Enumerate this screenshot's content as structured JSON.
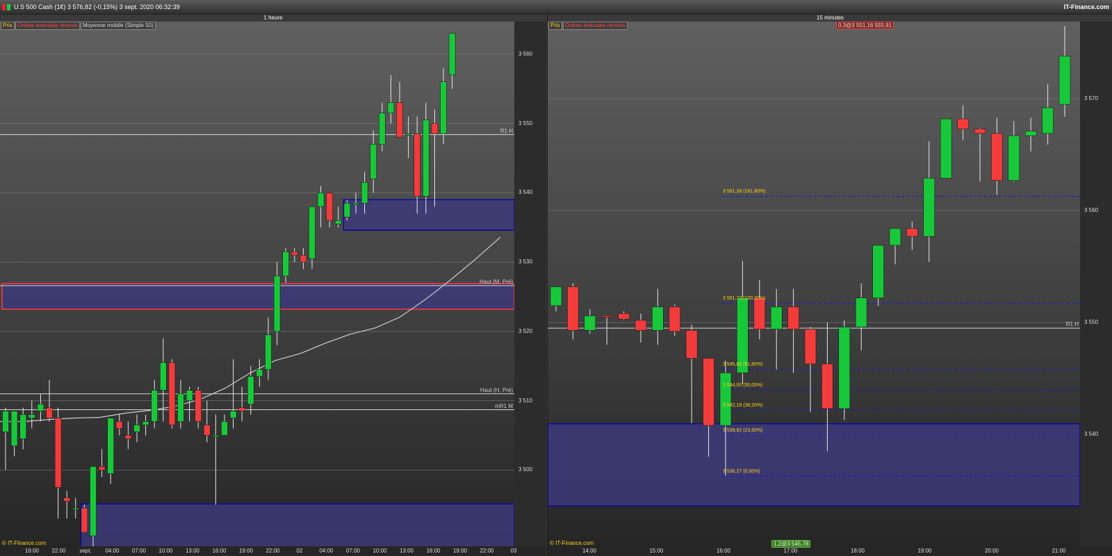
{
  "window": {
    "title": "U.S 500 Cash (1€)   3 576,82 (-0,15%)   3 sept. 2020 06:32:39",
    "brand": "IT-Finance.com"
  },
  "colors": {
    "up": "#19c83a",
    "down": "#f23c3c",
    "zone": "#3d3a7a",
    "zone_border": "#0a0a9a",
    "red_line": "#ff3a3a",
    "price_label": "#ffd21f"
  },
  "left_panel": {
    "timeframe": "1 heure",
    "tabs": [
      "Prix",
      "Ordres exécutés récents",
      "Moyenne mobile (Simple 50)"
    ],
    "copyright": "© IT-Finance.com",
    "y_ticks": [
      "3 560",
      "3 550",
      "3 540",
      "3 530",
      "3 520",
      "3 510",
      "3 500"
    ],
    "x_ticks": [
      "19:00",
      "22:00",
      "sept.",
      "04:00",
      "07:00",
      "10:00",
      "13:00",
      "16:00",
      "19:00",
      "22:00",
      "02",
      "04:00",
      "07:00",
      "10:00",
      "13:00",
      "16:00",
      "19:00",
      "22:00",
      "03"
    ],
    "levels": [
      {
        "label": "R1 H",
        "price": 3548.4
      },
      {
        "label": "Haut (M, Pré)",
        "price": 3526.6
      },
      {
        "label": "Haut (H, Pré)",
        "price": 3511.0
      },
      {
        "label": "mR1 M",
        "price": 3508.7
      }
    ],
    "candles": [
      [
        3505.5,
        3509,
        3500,
        3508.5
      ],
      [
        3503.5,
        3508,
        3502,
        3508.5
      ],
      [
        3504.5,
        3509,
        3503,
        3508
      ],
      [
        3507.5,
        3510,
        3506,
        3508
      ],
      [
        3508.5,
        3511,
        3507,
        3509.5
      ],
      [
        3509,
        3513,
        3507,
        3507.5
      ],
      [
        3507.5,
        3509,
        3493,
        3497.5
      ],
      [
        3496,
        3497,
        3493,
        3495.5
      ],
      [
        3494.5,
        3496,
        3493,
        3494.5
      ],
      [
        3494.5,
        3495,
        3492,
        3491
      ],
      [
        3490.5,
        3497,
        3489,
        3500.5
      ],
      [
        3500.5,
        3503,
        3499,
        3500
      ],
      [
        3499.5,
        3501,
        3498,
        3507.5
      ],
      [
        3507,
        3508,
        3505,
        3506
      ],
      [
        3505,
        3507,
        3503,
        3504.5
      ],
      [
        3505.5,
        3508,
        3504,
        3506.5
      ],
      [
        3506.5,
        3508,
        3505,
        3507
      ],
      [
        3507,
        3513,
        3506,
        3511.5
      ],
      [
        3511.5,
        3519,
        3507,
        3515.5
      ],
      [
        3515.5,
        3516,
        3506,
        3506.5
      ],
      [
        3507,
        3513,
        3506,
        3511
      ],
      [
        3510,
        3512,
        3507,
        3511.5
      ],
      [
        3511.5,
        3512,
        3506,
        3507
      ],
      [
        3506.5,
        3510,
        3504,
        3505
      ],
      [
        3505,
        3508,
        3495,
        3505
      ],
      [
        3505,
        3508,
        3505,
        3507
      ],
      [
        3507.5,
        3516,
        3506,
        3508.5
      ],
      [
        3509,
        3512,
        3507,
        3508.5
      ],
      [
        3509.5,
        3515,
        3508,
        3513.5
      ],
      [
        3513.5,
        3516,
        3512,
        3514.5
      ],
      [
        3514.5,
        3522,
        3513,
        3519.5
      ],
      [
        3520,
        3530,
        3518,
        3528
      ],
      [
        3528,
        3532,
        3527,
        3531.5
      ],
      [
        3531.5,
        3532,
        3530,
        3531
      ],
      [
        3531,
        3532,
        3529,
        3530
      ],
      [
        3530.5,
        3538,
        3529,
        3538
      ],
      [
        3538,
        3541,
        3535,
        3540
      ],
      [
        3540,
        3540,
        3535,
        3536
      ],
      [
        3535.5,
        3538,
        3535,
        3536
      ],
      [
        3536.5,
        3539,
        3536,
        3538.5
      ],
      [
        3538.5,
        3540,
        3537,
        3538.5
      ],
      [
        3538.5,
        3543,
        3537,
        3541.5
      ],
      [
        3542,
        3549,
        3540,
        3547
      ],
      [
        3547,
        3553,
        3546,
        3551.5
      ],
      [
        3551.5,
        3557,
        3550,
        3553
      ],
      [
        3553,
        3556,
        3550,
        3548
      ],
      [
        3548.5,
        3551,
        3545,
        3548.5
      ],
      [
        3548.5,
        3551,
        3537,
        3539.5
      ],
      [
        3539.5,
        3553,
        3537,
        3550.5
      ],
      [
        3550,
        3552,
        3538,
        3548.5
      ],
      [
        3548.5,
        3558,
        3547,
        3556
      ],
      [
        3557,
        3563,
        3555,
        3563
      ]
    ],
    "ma_series": [
      3507,
      3507,
      3507.3,
      3507.5,
      3507.6,
      3508.2,
      3508.6,
      3509.2,
      3510.2,
      3511.8,
      3514,
      3515.8,
      3516.8,
      3518.3,
      3519.6,
      3520.5,
      3522.1,
      3524.6,
      3527.4,
      3530.4,
      3533.6
    ],
    "zones": [
      {
        "top": 3539.0,
        "bottom": 3534.6,
        "start_index": 39
      },
      {
        "top": 3526.9,
        "bottom": 3523.2,
        "start_index": 0,
        "red": true
      },
      {
        "top": 3495.1,
        "bottom": 3488.0,
        "start_index": 9
      }
    ]
  },
  "right_panel": {
    "timeframe": "15 minutes",
    "tabs": [
      "Prix",
      "Ordres exécutés récents"
    ],
    "copyright": "© IT-Finance.com",
    "order_badge_top": "0,3@3 551,16 555,91",
    "order_badge_bottom": "1,2@3 545,78",
    "y_ticks": [
      "3 570",
      "3 560",
      "3 550",
      "3 540"
    ],
    "x_ticks": [
      "14:00",
      "15:00",
      "16:00",
      "17:00",
      "18:00",
      "19:00",
      "20:00",
      "21:00"
    ],
    "levels": [
      {
        "label": "R1 H",
        "price": 3549.5
      }
    ],
    "fib_levels": [
      {
        "label": "3 561,28 (161,80%)",
        "price": 3561.28
      },
      {
        "label": "3 551,73 (100,00%)",
        "price": 3551.73
      },
      {
        "label": "3 545,82 (61,80%)",
        "price": 3545.82
      },
      {
        "label": "3 544,00 (50,00%)",
        "price": 3544.0
      },
      {
        "label": "3 542,18 (38,20%)",
        "price": 3542.18
      },
      {
        "label": "3 539,92 (23,60%)",
        "price": 3539.92
      },
      {
        "label": "3 536,27 (0,00%)",
        "price": 3536.27
      }
    ],
    "candles": [
      [
        3551.5,
        3553,
        3551,
        3553.2
      ],
      [
        3553.2,
        3553.5,
        3548.5,
        3549.3
      ],
      [
        3549.3,
        3551.2,
        3549,
        3550.6
      ],
      [
        3550.6,
        3550.6,
        3548,
        3550.5
      ],
      [
        3550.8,
        3551,
        3550.2,
        3550.3
      ],
      [
        3550.2,
        3550.8,
        3548.2,
        3549.3
      ],
      [
        3549.3,
        3553,
        3548,
        3551.4
      ],
      [
        3551.4,
        3551.6,
        3548.8,
        3549.2
      ],
      [
        3549.3,
        3549.8,
        3541,
        3546.8
      ],
      [
        3546.8,
        3546.8,
        3538,
        3540.8
      ],
      [
        3540.8,
        3546.6,
        3536.3,
        3545.5
      ],
      [
        3545.5,
        3555.5,
        3544.5,
        3552.2
      ],
      [
        3552.2,
        3553.8,
        3548.5,
        3549.4
      ],
      [
        3549.4,
        3553,
        3545.8,
        3551.4
      ],
      [
        3551.4,
        3553,
        3545.5,
        3549.4
      ],
      [
        3549.4,
        3549.6,
        3542,
        3546.3
      ],
      [
        3546.3,
        3550,
        3538.5,
        3542.3
      ],
      [
        3542.3,
        3550.2,
        3541.3,
        3549.6
      ],
      [
        3549.6,
        3553.5,
        3547.5,
        3552.2
      ],
      [
        3552.2,
        3556.5,
        3551.5,
        3556.9
      ],
      [
        3556.9,
        3558.2,
        3555.2,
        3558.4
      ],
      [
        3558.4,
        3559,
        3556.5,
        3557.7
      ],
      [
        3557.7,
        3566.2,
        3555.4,
        3562.9
      ],
      [
        3562.9,
        3568.1,
        3563.2,
        3568.2
      ],
      [
        3568.2,
        3569.4,
        3566.3,
        3567.3
      ],
      [
        3567.3,
        3567.4,
        3562.6,
        3566.9
      ],
      [
        3566.9,
        3568.3,
        3561.4,
        3562.7
      ],
      [
        3562.7,
        3568,
        3562.6,
        3566.7
      ],
      [
        3566.7,
        3568.3,
        3565.3,
        3567.1
      ],
      [
        3566.9,
        3571.3,
        3565.9,
        3569.2
      ],
      [
        3569.5,
        3576.5,
        3568.4,
        3573.8
      ]
    ],
    "zone": {
      "top": 3540.95,
      "bottom": 3533.6
    }
  }
}
